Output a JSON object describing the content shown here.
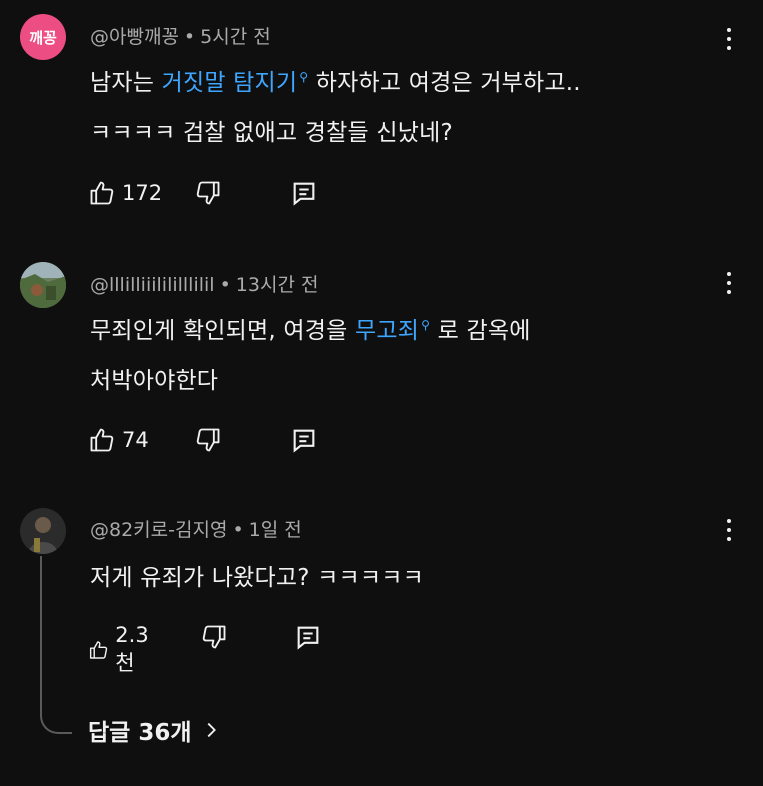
{
  "comments": [
    {
      "avatar_text": "깨꽁",
      "author": "@아빵깨꽁",
      "time": "5시간 전",
      "line1": {
        "pre": "남자는 ",
        "link": "거짓말 탐지기",
        "post": " 하자하고 여경은 거부하고.."
      },
      "line2": "ㅋㅋㅋㅋ 검찰 없애고 경찰들 신났네?",
      "likes": "172"
    },
    {
      "author": "@lllilliiilililllilil",
      "time": "13시간 전",
      "line1": {
        "pre": "무죄인게 확인되면, 여경을 ",
        "link": "무고죄",
        "post": " 로 감옥에"
      },
      "line2": "처박아야한다",
      "likes": "74"
    },
    {
      "author": "@82키로-김지영",
      "time": "1일 전",
      "line1": "저게 유죄가 나왔다고? ㅋㅋㅋㅋㅋ",
      "likes": "2.3천"
    }
  ],
  "replies_label": "답글 36개",
  "icons": {
    "like": "thumbs-up-icon",
    "dislike": "thumbs-down-icon",
    "reply": "reply-icon",
    "more": "more-vert-icon",
    "search": "search-icon",
    "chevron": "chevron-right-icon"
  },
  "colors": {
    "background": "#0f0f0f",
    "link": "#3ea6ff",
    "meta": "#aaaaaa",
    "avatar_bg": "#ec4d82"
  }
}
